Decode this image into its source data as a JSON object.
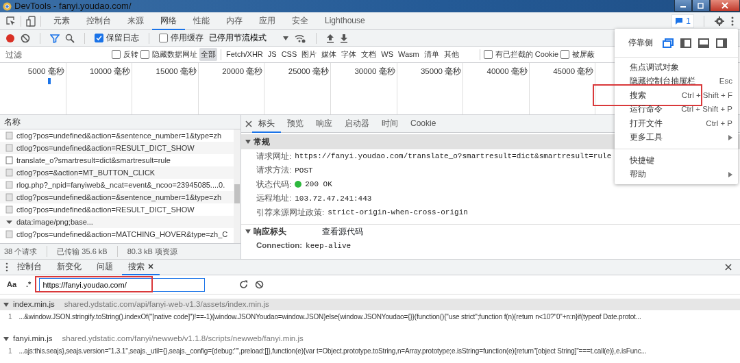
{
  "window": {
    "title": "DevTools - fanyi.youdao.com/"
  },
  "main_tabs": [
    {
      "label": "元素",
      "selected": false
    },
    {
      "label": "控制台",
      "selected": false
    },
    {
      "label": "来源",
      "selected": false
    },
    {
      "label": "网络",
      "selected": true
    },
    {
      "label": "性能",
      "selected": false
    },
    {
      "label": "内存",
      "selected": false
    },
    {
      "label": "应用",
      "selected": false
    },
    {
      "label": "安全",
      "selected": false
    },
    {
      "label": "Lighthouse",
      "selected": false
    }
  ],
  "issues_badge": "1",
  "toolbar": {
    "recording": true,
    "preserve_log": {
      "label": "保留日志",
      "checked": true
    },
    "disable_cache": {
      "label": "停用缓存",
      "checked": false
    },
    "throttling": "已停用节流模式"
  },
  "filter": {
    "placeholder": "过滤",
    "invert": {
      "label": "反转",
      "checked": false
    },
    "hide_data_urls": {
      "label": "隐藏数据网址",
      "checked": false
    },
    "types": [
      {
        "label": "全部",
        "selected": true
      },
      {
        "label": "Fetch/XHR",
        "selected": false
      },
      {
        "label": "JS",
        "selected": false
      },
      {
        "label": "CSS",
        "selected": false
      },
      {
        "label": "图片",
        "selected": false
      },
      {
        "label": "媒体",
        "selected": false
      },
      {
        "label": "字体",
        "selected": false
      },
      {
        "label": "文档",
        "selected": false
      },
      {
        "label": "WS",
        "selected": false
      },
      {
        "label": "Wasm",
        "selected": false
      },
      {
        "label": "清单",
        "selected": false
      },
      {
        "label": "其他",
        "selected": false
      }
    ],
    "blocked_cookies": {
      "label": "有已拦截的 Cookie",
      "checked": false
    },
    "blocked_requests": {
      "label": "被屏蔽",
      "checked": false
    }
  },
  "overview": {
    "ticks": [
      "5000 毫秒",
      "10000 毫秒",
      "15000 毫秒",
      "20000 毫秒",
      "25000 毫秒",
      "30000 毫秒",
      "35000 毫秒",
      "40000 毫秒",
      "45000 毫秒"
    ]
  },
  "requests": {
    "column": "名称",
    "rows": [
      {
        "name": "ctlog?pos=undefined&action=&sentence_number=1&type=zh",
        "kind": "log"
      },
      {
        "name": "ctlog?pos=undefined&action=RESULT_DICT_SHOW",
        "kind": "log"
      },
      {
        "name": "translate_o?smartresult=dict&smartresult=rule",
        "kind": "xhr"
      },
      {
        "name": "ctlog?pos=&action=MT_BUTTON_CLICK",
        "kind": "log"
      },
      {
        "name": "rlog.php?_npid=fanyiweb&_ncat=event&_ncoo=23945085....0.",
        "kind": "log"
      },
      {
        "name": "ctlog?pos=undefined&action=&sentence_number=1&type=zh",
        "kind": "log"
      },
      {
        "name": "ctlog?pos=undefined&action=RESULT_DICT_SHOW",
        "kind": "log"
      },
      {
        "name": "data:image/png;base...",
        "kind": "image"
      },
      {
        "name": "ctlog?pos=undefined&action=MATCHING_HOVER&type=zh_C",
        "kind": "log"
      }
    ],
    "summary": [
      "38 个请求",
      "已传输 35.6 kB",
      "80.3 kB 项资源"
    ]
  },
  "details": {
    "tabs": [
      {
        "label": "标头",
        "selected": true
      },
      {
        "label": "预览",
        "selected": false
      },
      {
        "label": "响应",
        "selected": false
      },
      {
        "label": "启动器",
        "selected": false
      },
      {
        "label": "时间",
        "selected": false
      },
      {
        "label": "Cookie",
        "selected": false
      }
    ],
    "general": {
      "title": "常规",
      "expanded": true,
      "rows": [
        {
          "key": "请求网址:",
          "value": "https://fanyi.youdao.com/translate_o?smartresult=dict&smartresult=rule"
        },
        {
          "key": "请求方法:",
          "value": "POST"
        },
        {
          "key": "状态代码:",
          "value": "200 OK",
          "color": "#2db83d"
        },
        {
          "key": "远程地址:",
          "value": "103.72.47.241:443"
        },
        {
          "key": "引荐来源网址政策:",
          "value": "strict-origin-when-cross-origin"
        }
      ]
    },
    "response_headers": {
      "title": "响应标头",
      "expanded": true,
      "view_source": "查看源代码",
      "rows": [
        {
          "key": "Connection:",
          "value": "keep-alive"
        }
      ]
    }
  },
  "drawer": {
    "tabs": [
      {
        "label": "控制台",
        "selected": false,
        "closable": false
      },
      {
        "label": "新变化",
        "selected": false,
        "closable": false
      },
      {
        "label": "问题",
        "selected": false,
        "closable": false
      },
      {
        "label": "搜索",
        "selected": true,
        "closable": true
      }
    ],
    "search": {
      "match_case": "Aa",
      "regex": ".*",
      "value": "https://fanyi.youdao.com/",
      "annotated": true
    },
    "results": [
      {
        "file": "index.min.js",
        "path": "shared.ydstatic.com/api/fanyi-web-v1.3/assets/index.min.js",
        "expanded": true,
        "lines": [
          {
            "number": "1",
            "text": "...&window.JSON.stringify.toString().indexOf(\"[native code]\")!==-1){window.JSONYoudao=window.JSON}else{window.JSONYoudao={}}(function(){\"use strict\";function f(n){return n<10?\"0\"+n:n}if(typeof Date.protot..."
          }
        ]
      },
      {
        "file": "fanyi.min.js",
        "path": "shared.ydstatic.com/fanyi/newweb/v1.1.8/scripts/newweb/fanyi.min.js",
        "expanded": true,
        "lines": [
          {
            "number": "1",
            "text": "...ajs:this.seajs},seajs.version=\"1.3.1\",seajs._util={},seajs._config={debug:\"\",preload:[]},function(e){var t=Object.prototype.toString,n=Array.prototype;e.isString=function(e){return\"[object String]\"===t.call(e)},e.isFunc..."
          }
        ]
      }
    ]
  },
  "menu": {
    "dock": {
      "label": "停靠侧",
      "options": [
        {
          "kind": "undock",
          "selected": true
        },
        {
          "kind": "left",
          "selected": false
        },
        {
          "kind": "bottom",
          "selected": false
        },
        {
          "kind": "right",
          "selected": false
        }
      ]
    },
    "groups": [
      [
        {
          "label": "焦点调试对象"
        },
        {
          "label": "隐藏控制台抽屉栏",
          "shortcut": "Esc"
        },
        {
          "label": "搜索",
          "shortcut": "Ctrl + Shift + F",
          "annotated": true
        },
        {
          "label": "运行命令",
          "shortcut": "Ctrl + Shift + P"
        },
        {
          "label": "打开文件",
          "shortcut": "Ctrl + P"
        },
        {
          "label": "更多工具",
          "submenu": true
        }
      ],
      [
        {
          "label": "快捷键"
        },
        {
          "label": "帮助",
          "submenu": true
        }
      ]
    ]
  }
}
